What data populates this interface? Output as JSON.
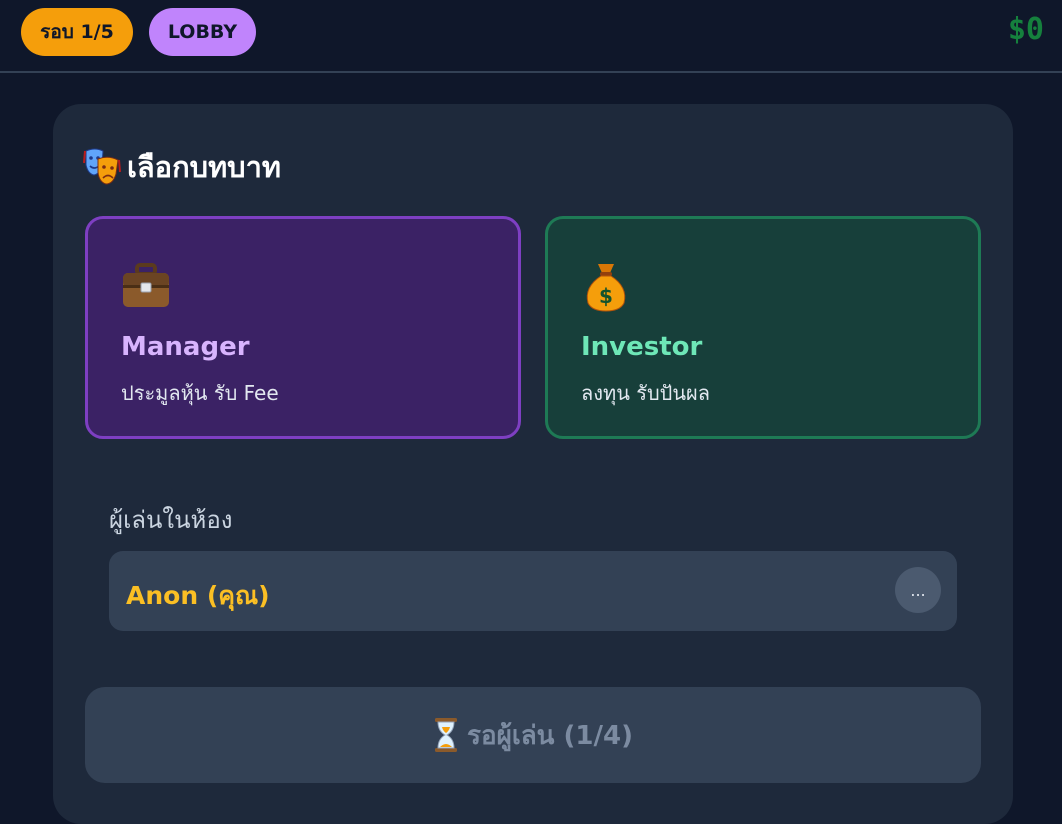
{
  "header": {
    "round_label": "รอบ 1/5",
    "phase_label": "LOBBY",
    "balance": "$0"
  },
  "role_select": {
    "title_icon": "theater-masks-icon",
    "title": "เลือกบทบาท",
    "roles": [
      {
        "icon": "briefcase-icon",
        "name": "Manager",
        "description": "ประมูลหุ้น รับ Fee",
        "color": "#d8b4fe"
      },
      {
        "icon": "money-bag-icon",
        "name": "Investor",
        "description": "ลงทุน รับปันผล",
        "color": "#6ee7b7"
      }
    ]
  },
  "players": {
    "label": "ผู้เล่นในห้อง",
    "list": [
      {
        "name": "Anon (คุณ)",
        "menu_label": "..."
      }
    ]
  },
  "wait_button": {
    "icon": "hourglass-icon",
    "label": "รอผู้เล่น (1/4)"
  }
}
